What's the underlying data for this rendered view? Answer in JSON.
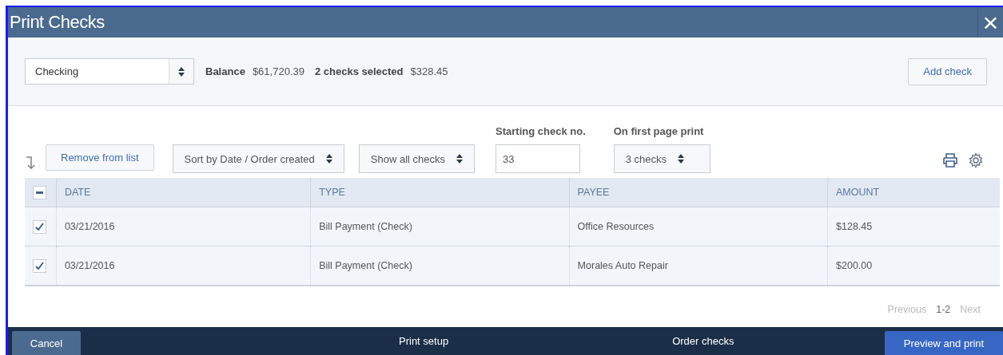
{
  "window": {
    "title": "Print Checks",
    "close": "×"
  },
  "account": {
    "value": "Checking",
    "balance_label": "Balance",
    "balance": "$61,720.39",
    "selected_label": "2 checks selected",
    "selected_total": "$328.45"
  },
  "add_check": "Add check",
  "toolbar": {
    "remove": "Remove from list",
    "sort": "Sort by Date / Order created",
    "filter": "Show all checks",
    "starting_label": "Starting check no.",
    "starting_value": "33",
    "first_page_label": "On first page print",
    "first_page_value": "3 checks"
  },
  "table": {
    "header_partial": true,
    "columns": [
      "DATE",
      "TYPE",
      "PAYEE",
      "AMOUNT"
    ],
    "rows": [
      {
        "checked": true,
        "cells": [
          "03/21/2016",
          "Bill Payment (Check)",
          "Office Resources",
          "$128.45"
        ]
      },
      {
        "checked": true,
        "cells": [
          "03/21/2016",
          "Bill Payment (Check)",
          "Morales Auto Repair",
          "$200.00"
        ]
      }
    ]
  },
  "pagination": {
    "previous": "Previous",
    "range": "1-2",
    "next": "Next"
  },
  "footer": {
    "cancel": "Cancel",
    "print_setup": "Print setup",
    "order_checks": "Order checks",
    "preview": "Preview and print"
  }
}
